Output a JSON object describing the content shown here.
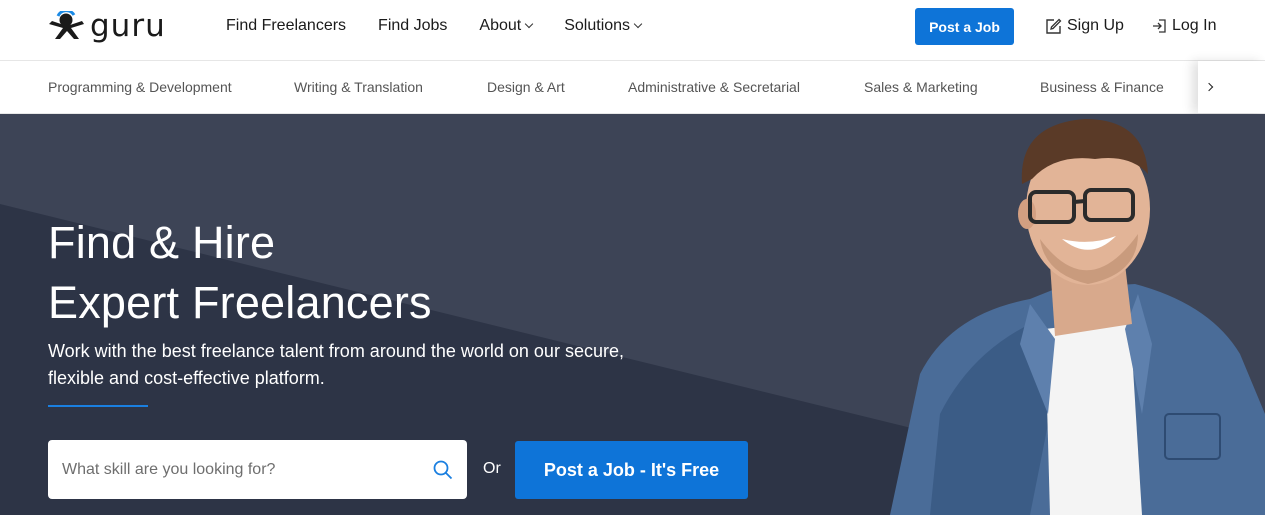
{
  "brand": {
    "name": "guru",
    "logo_icon": "guru-person-icon",
    "accent": "#0e74d8"
  },
  "nav": {
    "find_freelancers": "Find Freelancers",
    "find_jobs": "Find Jobs",
    "about": "About",
    "solutions": "Solutions",
    "post_job": "Post a Job",
    "sign_up": "Sign Up",
    "log_in": "Log In"
  },
  "categories": [
    "Programming & Development",
    "Writing & Translation",
    "Design & Art",
    "Administrative & Secretarial",
    "Sales & Marketing",
    "Business & Finance"
  ],
  "hero": {
    "title_line1": "Find & Hire",
    "title_line2": "Expert Freelancers",
    "subtitle": "Work with the best freelance talent from around the world on our secure, flexible and cost-effective platform.",
    "search_placeholder": "What skill are you looking for?",
    "or": "Or",
    "cta": "Post a Job - It's Free",
    "bg_color": "#3d4456"
  }
}
